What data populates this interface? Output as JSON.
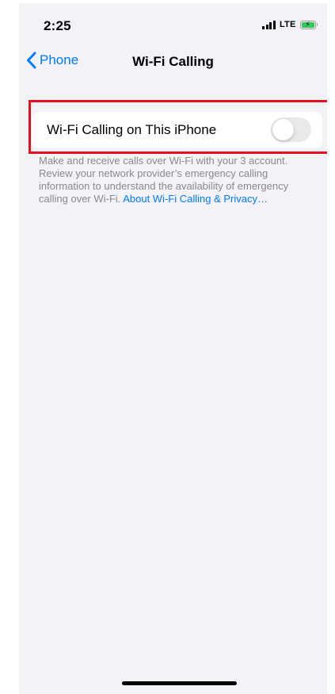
{
  "status_bar": {
    "time": "2:25",
    "network": "LTE",
    "battery_color": "#34c759",
    "charging": true,
    "icons": [
      "signal-icon",
      "battery-icon"
    ]
  },
  "nav": {
    "back_label": "Phone",
    "title": "Wi-Fi Calling",
    "accent_color": "#007aff"
  },
  "settings": {
    "wifi_calling_label": "Wi-Fi Calling on This iPhone",
    "wifi_calling_enabled": false
  },
  "footer": {
    "text": "Make and receive calls over Wi-Fi with your 3 account. Review your network provider’s emergency calling information to understand the availability of emergency calling over Wi-Fi.",
    "link_text": "About Wi-Fi Calling & Privacy…"
  },
  "highlight_color": "#e4121e"
}
